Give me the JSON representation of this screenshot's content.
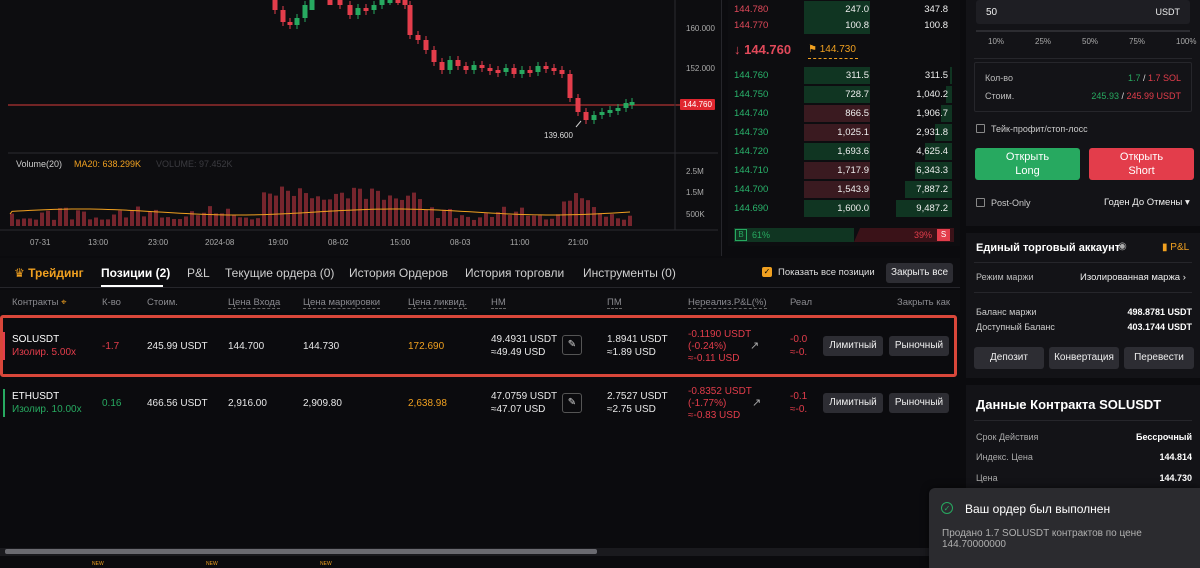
{
  "chart": {
    "price_tags": {
      "last": "144.760"
    },
    "y_ticks": [
      "160.000",
      "152.000"
    ],
    "low_label": "139.600",
    "volume_label": "Volume(20)",
    "ma_label": "MA20: 638.299K",
    "volume_ghost": "VOLUME: 97.452K",
    "vol_ticks": [
      "2.5M",
      "1.5M",
      "500K"
    ],
    "x_ticks": [
      "07-31",
      "13:00",
      "23:00",
      "2024-08",
      "19:00",
      "08-02",
      "15:00",
      "08-03",
      "11:00",
      "21:00"
    ]
  },
  "orderbook": {
    "asks": [
      {
        "price": "144.780",
        "qty": "247.0",
        "total": "347.8"
      },
      {
        "price": "144.770",
        "qty": "100.8",
        "total": "100.8"
      }
    ],
    "mid_price": "144.760",
    "mid_arrow": "↓",
    "mark_price": "144.730",
    "bids": [
      {
        "price": "144.760",
        "qty": "311.5",
        "total": "311.5"
      },
      {
        "price": "144.750",
        "qty": "728.7",
        "total": "1,040.2"
      },
      {
        "price": "144.740",
        "qty": "866.5",
        "total": "1,906.7"
      },
      {
        "price": "144.730",
        "qty": "1,025.1",
        "total": "2,931.8"
      },
      {
        "price": "144.720",
        "qty": "1,693.6",
        "total": "4,625.4"
      },
      {
        "price": "144.710",
        "qty": "1,717.9",
        "total": "6,343.3"
      },
      {
        "price": "144.700",
        "qty": "1,543.9",
        "total": "7,887.2"
      },
      {
        "price": "144.690",
        "qty": "1,600.0",
        "total": "9,487.2"
      }
    ],
    "buy_badge": "B",
    "buy_pct": "61%",
    "sell_pct": "39%",
    "sell_badge": "S"
  },
  "order_form": {
    "amount_value": "50",
    "amount_unit": "USDT",
    "percents": [
      "10%",
      "25%",
      "50%",
      "75%",
      "100%"
    ],
    "qty_label": "Кол-во",
    "qty_long": "1.7",
    "qty_short": "1.7 SOL",
    "cost_label": "Стоим.",
    "cost_long": "245.93",
    "cost_short": "245.99 USDT",
    "tpsl_label": "Тейк-профит/стоп-лосс",
    "open_long_1": "Открыть",
    "open_long_2": "Long",
    "open_short_1": "Открыть",
    "open_short_2": "Short",
    "post_only": "Post-Only",
    "tif": "Годен До Отмены"
  },
  "account": {
    "title": "Единый торговый аккаунт",
    "pnl_link": "P&L",
    "margin_mode_label": "Режим маржи",
    "margin_mode_value": "Изолированная маржа",
    "balance_label": "Баланс маржи",
    "balance_value": "498.8781 USDT",
    "available_label": "Доступный Баланс",
    "available_value": "403.1744 USDT",
    "deposit": "Депозит",
    "convert": "Конвертация",
    "transfer": "Перевести"
  },
  "contract": {
    "title": "Данные Контракта SOLUSDT",
    "expiry_label": "Срок Действия",
    "expiry_value": "Бессрочный",
    "index_label": "Индекс. Цена",
    "index_value": "144.814",
    "price_label": "Цена",
    "price_value": "144.730"
  },
  "tabs": {
    "trading": "Трейдинг",
    "positions": "Позиции (2)",
    "pnl": "P&L",
    "open_orders": "Текущие ордера (0)",
    "order_history": "История Ордеров",
    "trade_history": "История торговли",
    "tools": "Инструменты (0)",
    "show_all": "Показать все позиции",
    "close_all": "Закрыть все"
  },
  "columns": [
    "Контракты",
    "К-во",
    "Стоим.",
    "Цена Входа",
    "Цена маркировки",
    "Цена ликвид.",
    "НМ",
    "ПМ",
    "Нереализ.P&L(%)",
    "Реал",
    "Закрыть как"
  ],
  "positions": [
    {
      "symbol": "SOLUSDT",
      "mode": "Изолир. 5.00x",
      "qty": "-1.7",
      "cost": "245.99 USDT",
      "entry": "144.700",
      "mark": "144.730",
      "liq": "172.690",
      "im1": "49.4931 USDT",
      "im2": "≈49.49 USD",
      "mm1": "1.8941 USDT",
      "mm2": "≈1.89 USD",
      "pnl1": "-0.1190 USDT",
      "pnl2": "(-0.24%)",
      "pnl3": "≈-0.11 USD",
      "real1": "-0.0",
      "real2": "≈-0.",
      "limit": "Лимитный",
      "market": "Рыночный"
    },
    {
      "symbol": "ETHUSDT",
      "mode": "Изолир. 10.00x",
      "qty": "0.16",
      "cost": "466.56 USDT",
      "entry": "2,916.00",
      "mark": "2,909.80",
      "liq": "2,638.98",
      "im1": "47.0759 USDT",
      "im2": "≈47.07 USD",
      "mm1": "2.7527 USDT",
      "mm2": "≈2.75 USD",
      "pnl1": "-0.8352 USDT",
      "pnl2": "(-1.77%)",
      "pnl3": "≈-0.83 USD",
      "real1": "-0.1",
      "real2": "≈-0.",
      "limit": "Лимитный",
      "market": "Рыночный"
    }
  ],
  "toast": {
    "title": "Ваш ордер был выполнен",
    "body1": "Продано 1.7 SOLUSDT контрактов по цене",
    "body2": "144.70000000"
  },
  "footer_new": "NEW",
  "colors": {
    "green": "#27a960",
    "red": "#e33d4b",
    "orange": "#f0a020"
  }
}
